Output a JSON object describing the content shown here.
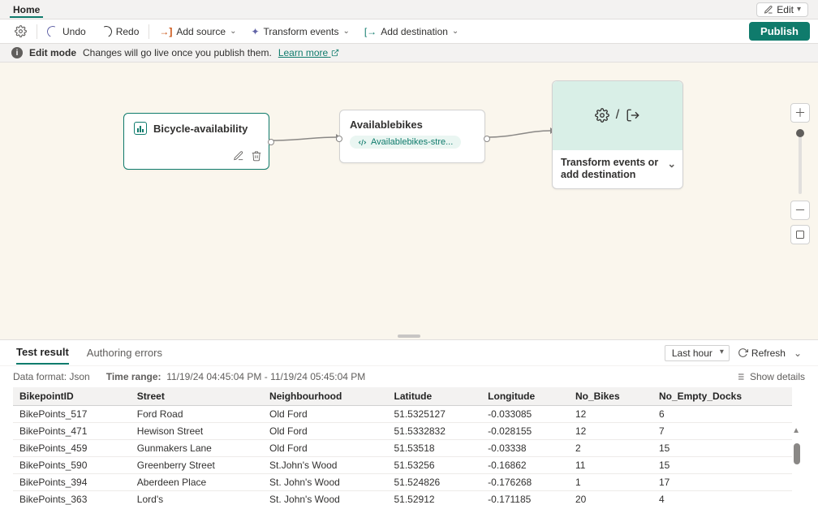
{
  "tabs": {
    "home": "Home"
  },
  "editMenu": {
    "label": "Edit"
  },
  "toolbar": {
    "undo": "Undo",
    "redo": "Redo",
    "addSource": "Add source",
    "transform": "Transform events",
    "addDest": "Add destination",
    "publish": "Publish"
  },
  "banner": {
    "mode": "Edit mode",
    "msg": "Changes will go live once you publish them.",
    "link": "Learn more"
  },
  "nodes": {
    "source": {
      "title": "Bicycle-availability"
    },
    "mid": {
      "title": "Availablebikes",
      "chip": "Availablebikes-stre..."
    },
    "dest": {
      "text": "Transform events or add destination"
    }
  },
  "panel": {
    "tabs": {
      "result": "Test result",
      "errors": "Authoring errors"
    },
    "rangeSelect": "Last hour",
    "refresh": "Refresh",
    "dataFormatLabel": "Data format:",
    "dataFormat": "Json",
    "timeRangeLabel": "Time range:",
    "timeRange": "11/19/24 04:45:04 PM - 11/19/24 05:45:04 PM",
    "showDetails": "Show details"
  },
  "table": {
    "headers": [
      "BikepointID",
      "Street",
      "Neighbourhood",
      "Latitude",
      "Longitude",
      "No_Bikes",
      "No_Empty_Docks"
    ],
    "rows": [
      [
        "BikePoints_517",
        "Ford Road",
        "Old Ford",
        "51.5325127",
        "-0.033085",
        "12",
        "6"
      ],
      [
        "BikePoints_471",
        "Hewison Street",
        "Old Ford",
        "51.5332832",
        "-0.028155",
        "12",
        "7"
      ],
      [
        "BikePoints_459",
        "Gunmakers Lane",
        "Old Ford",
        "51.53518",
        "-0.03338",
        "2",
        "15"
      ],
      [
        "BikePoints_590",
        "Greenberry Street",
        "St.John's Wood",
        "51.53256",
        "-0.16862",
        "11",
        "15"
      ],
      [
        "BikePoints_394",
        "Aberdeen Place",
        "St. John's Wood",
        "51.524826",
        "-0.176268",
        "1",
        "17"
      ],
      [
        "BikePoints_363",
        "Lord's",
        "St. John's Wood",
        "51.52912",
        "-0.171185",
        "20",
        "4"
      ]
    ]
  }
}
